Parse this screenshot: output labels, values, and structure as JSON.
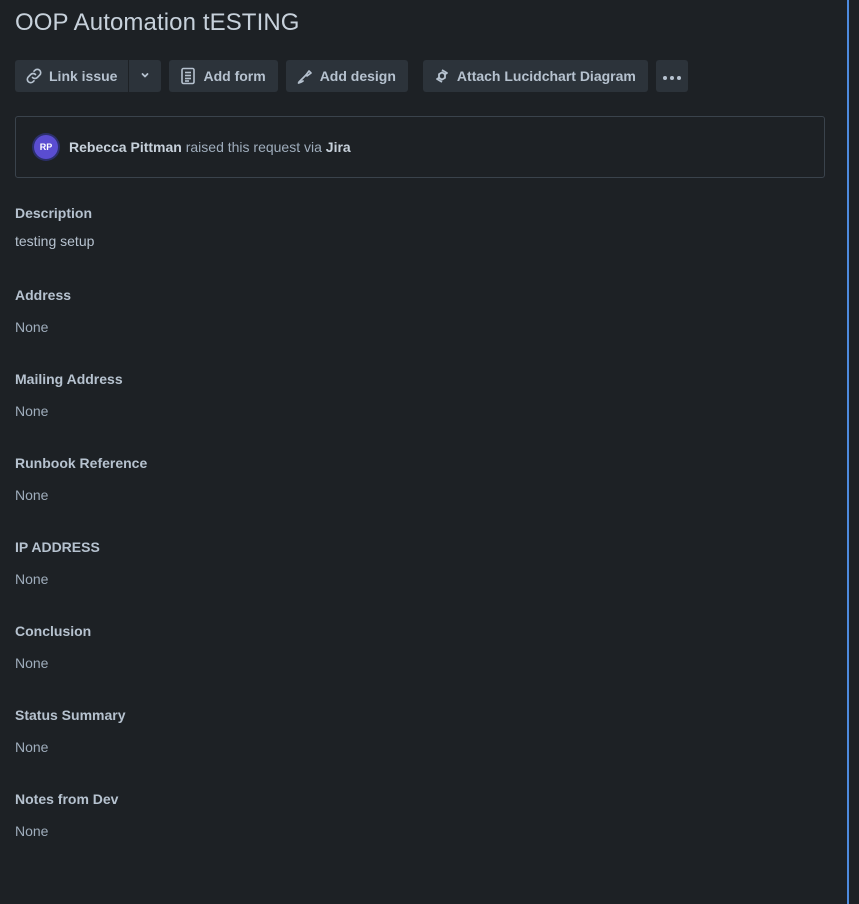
{
  "page": {
    "title": "OOP Automation tESTING"
  },
  "toolbar": {
    "link_issue_label": "Link issue",
    "link_issue_icon": "link-icon",
    "dropdown_icon": "chevron-down-icon",
    "add_form_label": "Add form",
    "add_form_icon": "form-icon",
    "add_design_label": "Add design",
    "add_design_icon": "design-icon",
    "lucidchart_label": "Attach Lucidchart Diagram",
    "lucidchart_icon": "lucidchart-icon",
    "more_icon": "more-icon"
  },
  "request": {
    "avatar_initials": "RP",
    "reporter_name": "Rebecca Pittman",
    "middle_text": " raised this request via ",
    "channel": "Jira"
  },
  "fields": {
    "description": {
      "label": "Description",
      "value": "testing setup"
    },
    "address": {
      "label": "Address",
      "value": "None"
    },
    "mailing_address": {
      "label": "Mailing Address",
      "value": "None"
    },
    "runbook_reference": {
      "label": "Runbook Reference",
      "value": "None"
    },
    "ip_address": {
      "label": "IP ADDRESS",
      "value": "None"
    },
    "conclusion": {
      "label": "Conclusion",
      "value": "None"
    },
    "status_summary": {
      "label": "Status Summary",
      "value": "None"
    },
    "notes_from_dev": {
      "label": "Notes from Dev",
      "value": "None"
    }
  },
  "colors": {
    "background": "#1d2125",
    "button_bg": "#2c333a",
    "text": "#b6c2cf",
    "muted": "#9fadbc",
    "avatar": "#5a4dd1",
    "accent": "#579dff"
  }
}
